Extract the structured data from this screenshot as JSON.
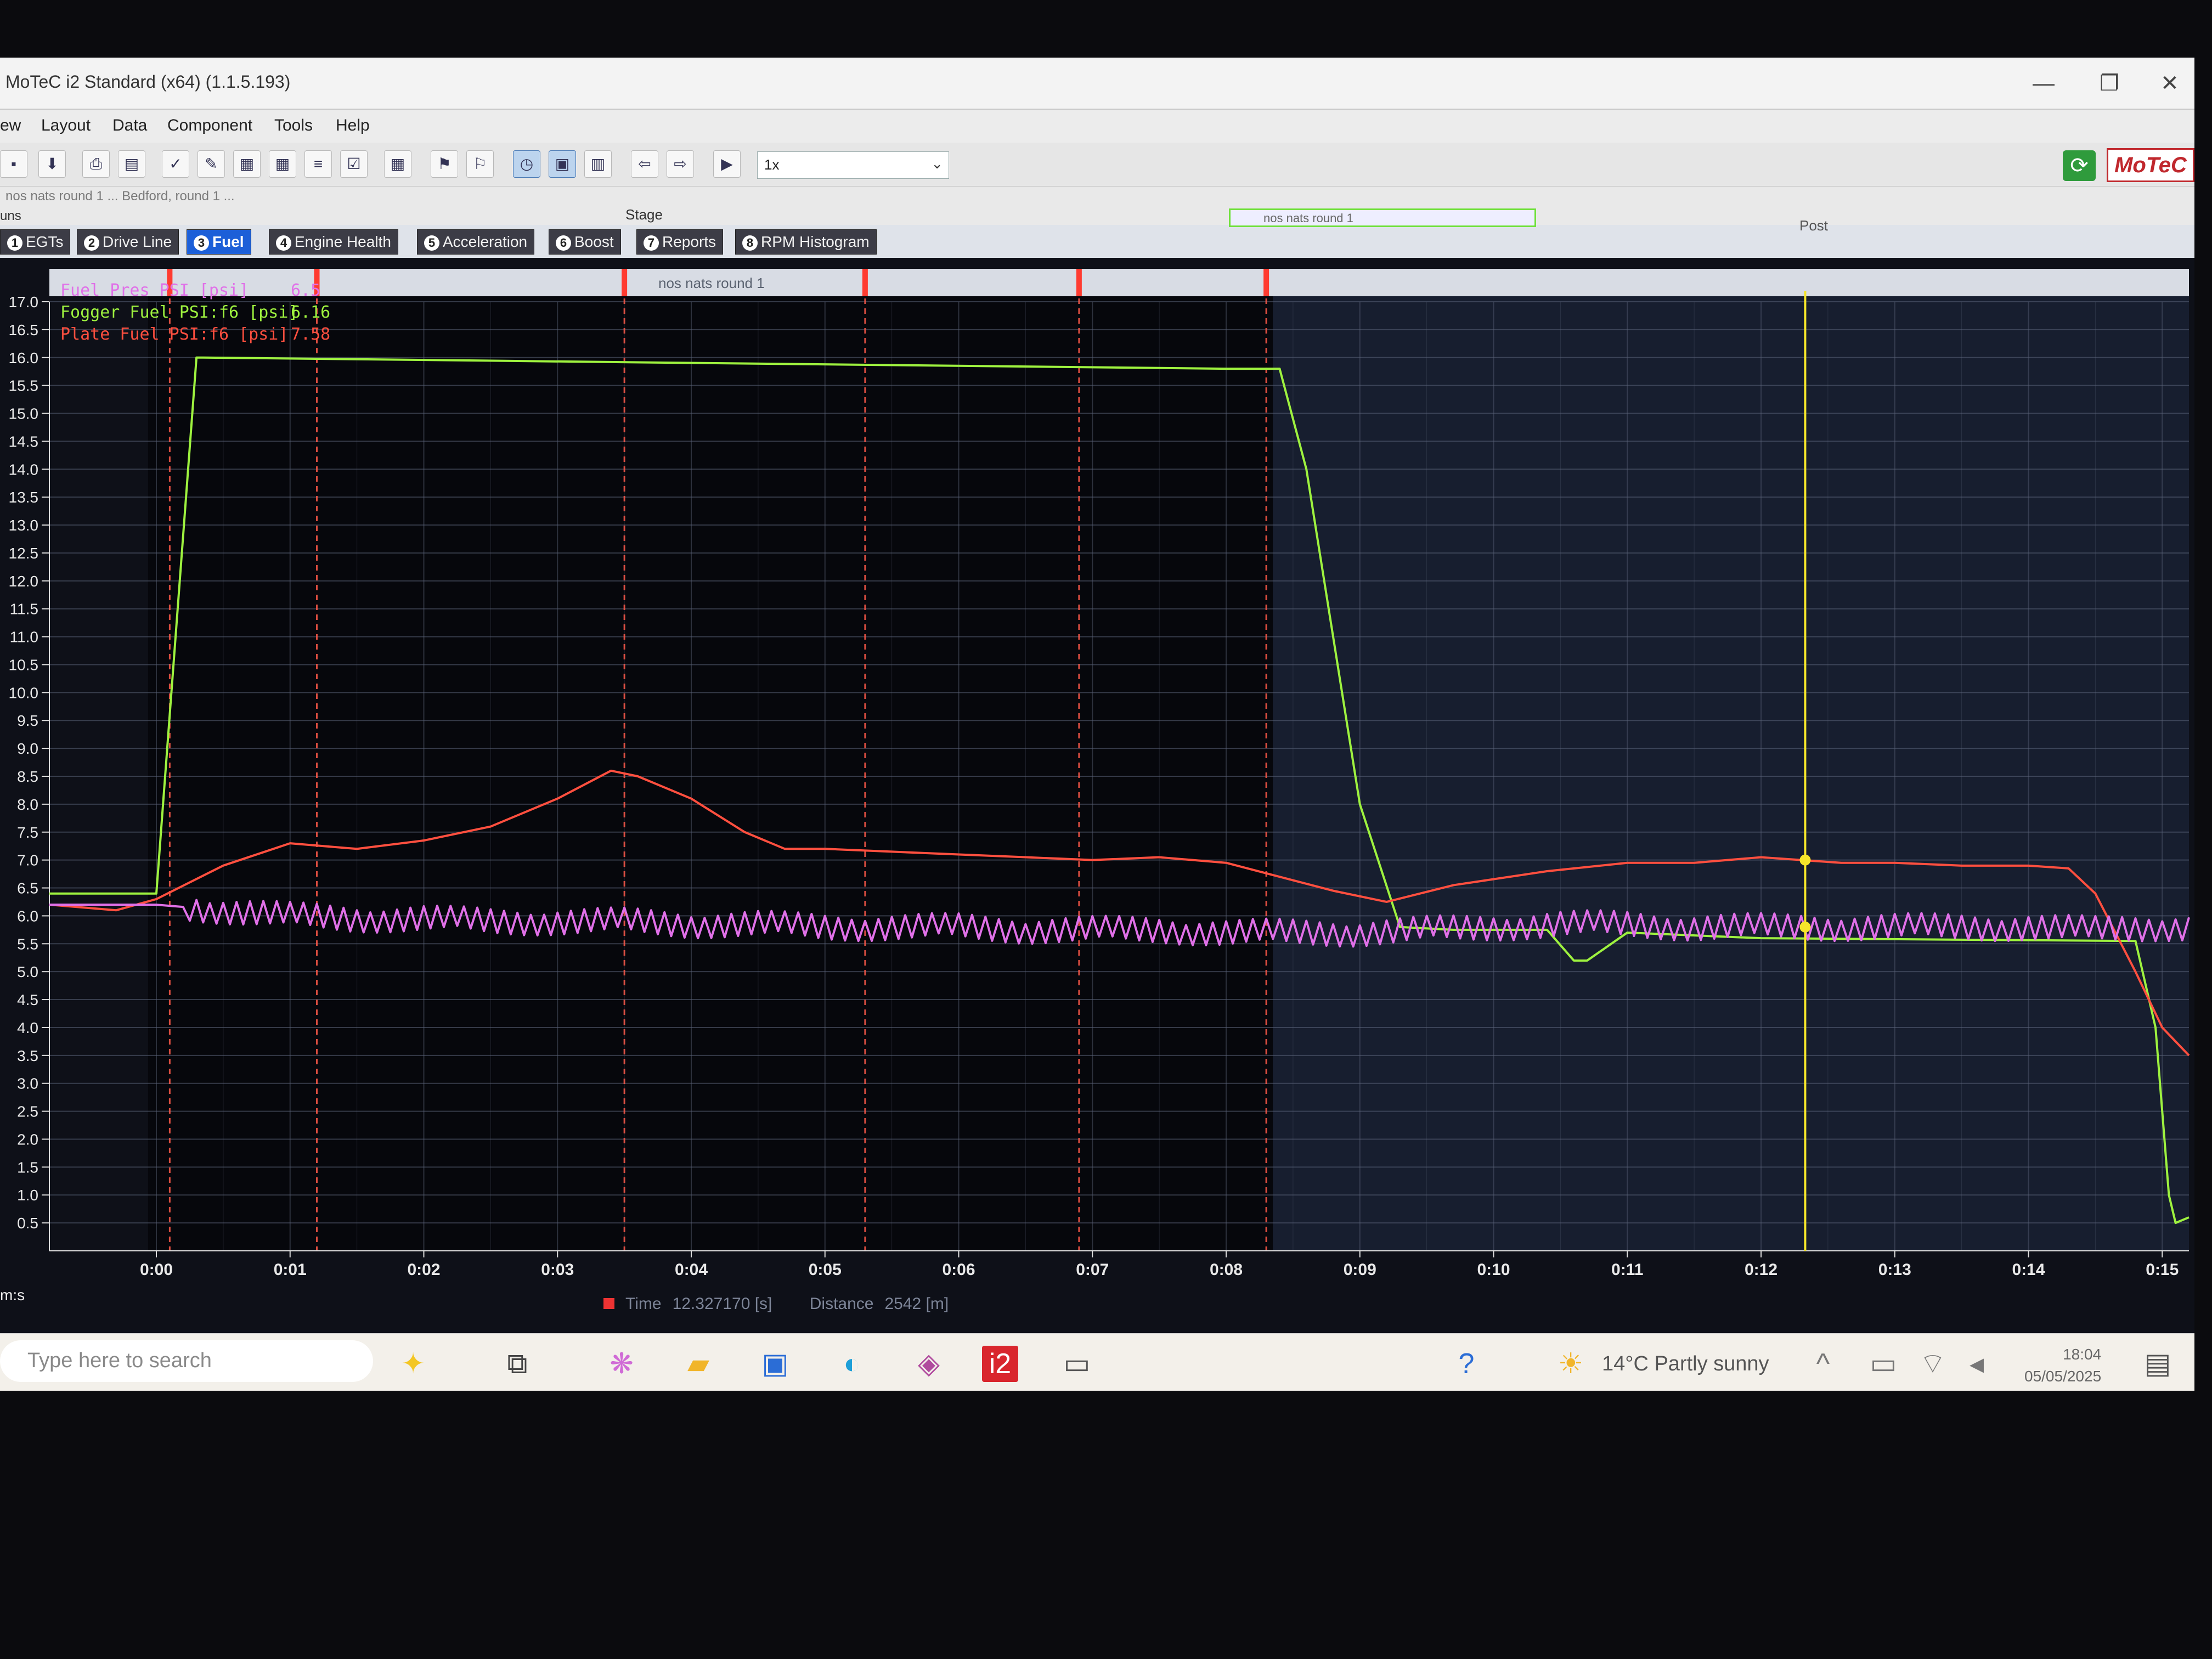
{
  "window": {
    "title": "MoTeC i2 Standard (x64) (1.1.5.193)",
    "controls": [
      "—",
      "❐",
      "✕"
    ]
  },
  "menu": [
    "ew",
    "Layout",
    "Data",
    "Component",
    "Tools",
    "Help"
  ],
  "toolbar": {
    "speed": "1x",
    "logo": "MoTeC"
  },
  "infobar": {
    "file_text": "nos nats round 1 ... Bedford, round 1 ...",
    "stage_label": "Stage",
    "post_label": "Post",
    "runs_label": "uns",
    "stage_box_label": "nos nats round 1"
  },
  "tabs": [
    {
      "num": "1",
      "label": "EGTs"
    },
    {
      "num": "2",
      "label": "Drive Line"
    },
    {
      "num": "3",
      "label": "Fuel",
      "active": true
    },
    {
      "num": "4",
      "label": "Engine Health"
    },
    {
      "num": "5",
      "label": "Acceleration"
    },
    {
      "num": "6",
      "label": "Boost"
    },
    {
      "num": "7",
      "label": "Reports"
    },
    {
      "num": "8",
      "label": "RPM Histogram"
    }
  ],
  "graph": {
    "segment_label": "nos nats round 1",
    "axis_unit": "m:s",
    "legend": [
      {
        "name": "Fuel Pres PSI [psi]",
        "value": "6.5",
        "color": "#e070e8"
      },
      {
        "name": "Fogger Fuel PSI:f6 [psi]",
        "value": "6.16",
        "color": "#9ef23f"
      },
      {
        "name": "Plate Fuel PSI:f6 [psi]",
        "value": "7.58",
        "color": "#ff4f3f"
      }
    ]
  },
  "chart_data": {
    "type": "line",
    "xlabel": "m:s",
    "ylim": [
      0,
      17
    ],
    "xlim": [
      -0.8,
      15.2
    ],
    "y_ticks": [
      "0.5",
      "1.0",
      "1.5",
      "2.0",
      "2.5",
      "3.0",
      "3.5",
      "4.0",
      "4.5",
      "5.0",
      "5.5",
      "6.0",
      "6.5",
      "7.0",
      "7.5",
      "8.0",
      "8.5",
      "9.0",
      "9.5",
      "10.0",
      "10.5",
      "11.0",
      "11.5",
      "12.0",
      "12.5",
      "13.0",
      "13.5",
      "14.0",
      "14.5",
      "15.0",
      "15.5",
      "16.0",
      "16.5",
      "17.0"
    ],
    "x_ticks": [
      "0:00",
      "0:01",
      "0:02",
      "0:03",
      "0:04",
      "0:05",
      "0:06",
      "0:07",
      "0:08",
      "0:09",
      "0:10",
      "0:11",
      "0:12",
      "0:13",
      "0:14",
      "0:15"
    ],
    "cursor_x": 12.33,
    "markers_x": [
      0.1,
      1.2,
      3.5,
      5.3,
      6.9,
      8.3
    ],
    "series": [
      {
        "name": "Fogger Fuel PSI:f6 [psi]",
        "color": "#9ef23f",
        "x": [
          -0.8,
          0.0,
          0.3,
          0.35,
          8.0,
          8.4,
          8.6,
          9.0,
          9.3,
          9.7,
          10.4,
          10.6,
          10.7,
          11.0,
          12.0,
          14.8,
          14.95,
          15.05,
          15.1,
          15.2
        ],
        "y": [
          6.4,
          6.4,
          16.0,
          16.0,
          15.8,
          15.8,
          14.0,
          8.0,
          5.8,
          5.75,
          5.75,
          5.2,
          5.2,
          5.7,
          5.6,
          5.55,
          4.0,
          1.0,
          0.5,
          0.6
        ]
      },
      {
        "name": "Plate Fuel PSI:f6 [psi]",
        "color": "#ff4f3f",
        "x": [
          -0.8,
          -0.3,
          0.0,
          0.5,
          1.0,
          1.5,
          2.0,
          2.5,
          3.0,
          3.4,
          3.6,
          4.0,
          4.4,
          4.7,
          5.0,
          5.5,
          6.0,
          6.5,
          7.0,
          7.5,
          8.0,
          8.4,
          8.8,
          9.2,
          9.7,
          10.4,
          11.0,
          11.5,
          12.0,
          12.3,
          12.6,
          13.0,
          13.5,
          14.0,
          14.3,
          14.5,
          14.8,
          15.0,
          15.2
        ],
        "y": [
          6.2,
          6.1,
          6.3,
          6.9,
          7.3,
          7.2,
          7.35,
          7.6,
          8.1,
          8.6,
          8.5,
          8.1,
          7.5,
          7.2,
          7.2,
          7.15,
          7.1,
          7.05,
          7.0,
          7.05,
          6.95,
          6.7,
          6.45,
          6.25,
          6.55,
          6.8,
          6.95,
          6.95,
          7.05,
          7.0,
          6.95,
          6.95,
          6.9,
          6.9,
          6.85,
          6.4,
          5.0,
          4.0,
          3.5
        ]
      },
      {
        "name": "Fuel Pres PSI [psi]",
        "color": "#e070e8",
        "x": [
          -0.8,
          0.0,
          0.5,
          1.0,
          1.5,
          2.0,
          2.5,
          3.0,
          3.5,
          4.0,
          4.5,
          5.0,
          5.5,
          6.0,
          6.5,
          7.0,
          7.5,
          8.0,
          8.5,
          9.0,
          9.5,
          10.0,
          10.5,
          11.0,
          11.5,
          12.0,
          12.5,
          13.0,
          13.5,
          14.0,
          14.5,
          15.0,
          15.2
        ],
        "y": [
          6.2,
          6.2,
          6.1,
          6.0,
          5.95,
          5.95,
          5.9,
          5.9,
          5.9,
          5.85,
          5.85,
          5.8,
          5.8,
          5.8,
          5.75,
          5.75,
          5.75,
          5.7,
          5.7,
          5.7,
          5.75,
          5.8,
          5.85,
          5.85,
          5.8,
          5.8,
          5.8,
          5.8,
          5.8,
          5.8,
          5.75,
          5.8,
          5.8
        ],
        "oscillation_psi": 0.25
      }
    ]
  },
  "status": {
    "time_label": "Time",
    "time_value": "12.327170 [s]",
    "distance_label": "Distance",
    "distance_value": "2542 [m]"
  },
  "taskbar": {
    "search_placeholder": "Type here to search",
    "weather": "14°C  Partly sunny",
    "time": "18:04",
    "date": "05/05/2025"
  }
}
